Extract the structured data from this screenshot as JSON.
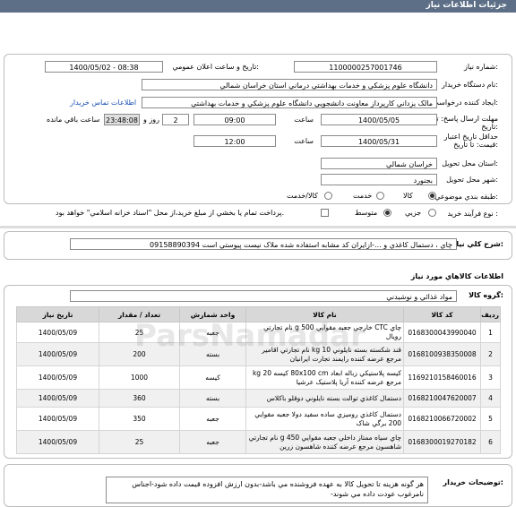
{
  "header": {
    "title": "جزئيات اطلاعات نياز"
  },
  "form": {
    "need_number": {
      "label": "شماره نياز:",
      "value": "1100000257001746"
    },
    "announce_datetime": {
      "label": "تاريخ و ساعت اعلان عمومي:",
      "value": "1400/05/02 - 08:38"
    },
    "buyer_org": {
      "label": "نام دستگاه خريدار:",
      "value": "دانشگاه علوم پزشکي و خدمات بهداشتي درماني استان خراسان شمالي"
    },
    "requester": {
      "label": "ايجاد کننده درخواست:",
      "value": "مالک يزداني کارپرداز معاونت دانشجويي دانشگاه علوم پزشکي و خدمات بهداشتي",
      "contact_link": "اطلاعات تماس خريدار"
    },
    "response_deadline": {
      "label": "مهلت ارسال پاسخ: تا تاريخ:",
      "date": "1400/05/05",
      "time_label": "ساعت",
      "time": "09:00",
      "days": "2",
      "days_label": "روز و",
      "remaining_time": "23:48:08",
      "remaining_label": "ساعت باقي مانده"
    },
    "price_validity": {
      "label": "حداقل تاريخ اعتبار قيمت: تا تاريخ:",
      "date": "1400/05/31",
      "time_label": "ساعت",
      "time": "12:00"
    },
    "delivery_province": {
      "label": "استان محل تحويل:",
      "value": "خراسان شمالي"
    },
    "delivery_city": {
      "label": "شهر محل تحويل:",
      "value": "بجنورد"
    },
    "category": {
      "label": "طبقه بندي موضوعي:",
      "options": [
        "کالا",
        "خدمت",
        "کالا/خدمت"
      ],
      "selected": "کالا"
    },
    "purchase_process": {
      "label": "نوع فرآيند خريد :",
      "options": [
        "جزيي",
        "متوسط"
      ],
      "selected": "متوسط",
      "payment_note": "پرداخت تمام يا بخشي از مبلغ خريد،از محل \"اسناد خزانه اسلامي\" خواهد بود."
    }
  },
  "description": {
    "label": "شرح کلي نياز:",
    "value": "چاي ، دستمال کاغذي و ...-ازايران کد مشابه استفاده شده ملاک نيست پيوستي است 09158890394"
  },
  "goods_section": {
    "title": "اطلاعات کالاهاي مورد نياز"
  },
  "goods_group": {
    "label": "گروه کالا:",
    "value": "مواد غذائي و نوشيدني"
  },
  "table": {
    "headers": [
      "رديف",
      "کد کالا",
      "نام کالا",
      "واحد شمارش",
      "تعداد / مقدار",
      "تاريخ نياز"
    ],
    "rows": [
      [
        "1",
        "0168300043990040",
        "چاي CTC خارجي جعبه مقوايي 500 g نام تجارتي رويال",
        "جعبه",
        "25",
        "1400/05/09"
      ],
      [
        "2",
        "0168100938350008",
        "قند شکسته بسته نايلوني 10 kg نام تجارتي اقامير مرجع عرضه کننده رايمند تجارت ايرانيان",
        "بسته",
        "200",
        "1400/05/09"
      ],
      [
        "3",
        "1169210158460016",
        "کيسه پلاستيکي زباله ابعاد 80x100 cm کيسه 20 kg مرجع عرضه کننده آريا پلاستيک عرشيا",
        "کيسه",
        "1000",
        "1400/05/09"
      ],
      [
        "4",
        "0168210047620007",
        "دستمال کاغذي توالت بسته نايلوني دوقلو باکلاس",
        "بسته",
        "360",
        "1400/05/09"
      ],
      [
        "5",
        "0168210066720002",
        "دستمال کاغذي روميزي ساده سفيد دولا جعبه مقوايي 200 برگي شاک",
        "جعبه",
        "350",
        "1400/05/09"
      ],
      [
        "6",
        "0168300019270182",
        "چاي سياه ممتاز داخلي جعبه مقوايي 450 g نام تجارتي شاهسون مرجع عرضه کننده شاهسون زرين",
        "جعبه",
        "25",
        "1400/05/09"
      ]
    ]
  },
  "buyer_notes": {
    "label": "توضيحات خريدار:",
    "value": "هر گونه هزينه تا تحويل کالا به عهده فروشنده مي باشد-بدون ارزش افزوده قيمت داده شود-اجناس نامرغوب عودت داده مي شوند-"
  },
  "watermark": {
    "text": "ParsNamadar"
  }
}
